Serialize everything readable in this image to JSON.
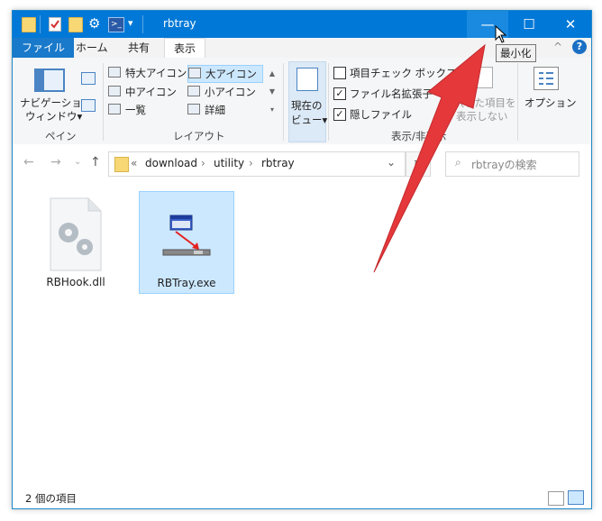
{
  "window": {
    "title": "rbtray",
    "controls": {
      "minimize": "—",
      "maximize": "☐",
      "close": "✕"
    },
    "tooltip": "最小化"
  },
  "quick_access": {
    "dropdown": "▾"
  },
  "ribbon_tabs": [
    "ファイル",
    "ホーム",
    "共有",
    "表示"
  ],
  "ribbon": {
    "pane": {
      "nav_pane_line1": "ナビゲーション",
      "nav_pane_line2": "ウィンドウ▾",
      "group_label": "ペイン"
    },
    "layout": {
      "items": [
        "特大アイコン",
        "大アイコン",
        "中アイコン",
        "小アイコン",
        "一覧",
        "詳細"
      ],
      "group_label": "レイアウト"
    },
    "current_view": {
      "line1": "現在の",
      "line2": "ビュー▾"
    },
    "show_hide": {
      "item_checkboxes": "項目チェック ボックス",
      "file_ext": "ファイル名拡張子",
      "hidden_items": "隠しファイル",
      "hide_selected_line1": "選択した項目を",
      "hide_selected_line2": "表示しない",
      "group_label": "表示/非表示"
    },
    "options": "オプション"
  },
  "address_bar": {
    "path": [
      "«",
      "download",
      "utility",
      "rbtray"
    ],
    "search_placeholder": "rbtrayの検索"
  },
  "files": [
    {
      "name": "RBHook.dll",
      "icon": "dll-gear-icon"
    },
    {
      "name": "RBTray.exe",
      "icon": "rbtray-app-icon"
    }
  ],
  "status": {
    "count": "2 個の項目"
  },
  "colors": {
    "titlebar": "#0078d7",
    "accent_arrow": "#e8383d",
    "selection": "#cce8ff"
  }
}
